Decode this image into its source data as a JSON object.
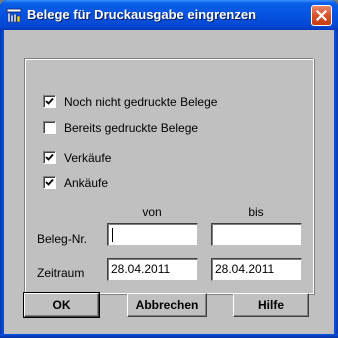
{
  "window": {
    "title": "Belege für Druckausgabe eingrenzen",
    "icon": "printer-filter-icon",
    "close_icon": "close-icon",
    "colors": {
      "titlebar": "#0553e0",
      "close_button": "#d9532a",
      "dialog_bg": "#c0c0c0"
    }
  },
  "filters": {
    "not_printed": {
      "label": "Noch nicht gedruckte Belege",
      "checked": true
    },
    "already_printed": {
      "label": "Bereits gedruckte Belege",
      "checked": false
    },
    "sales": {
      "label": "Verkäufe",
      "checked": true
    },
    "purchases": {
      "label": "Ankäufe",
      "checked": true
    }
  },
  "range": {
    "from_header": "von",
    "to_header": "bis",
    "beleg_nr": {
      "label": "Beleg-Nr.",
      "from_value": "",
      "to_value": ""
    },
    "zeitraum": {
      "label": "Zeitraum",
      "from_value": "28.04.2011",
      "to_value": "28.04.2011"
    }
  },
  "buttons": {
    "ok": "OK",
    "cancel": "Abbrechen",
    "help": "Hilfe"
  }
}
